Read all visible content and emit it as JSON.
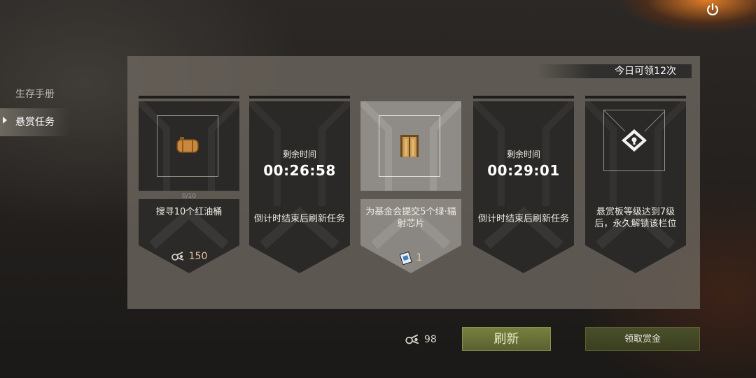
{
  "colors": {
    "panel": "#6e6860",
    "card_dark": "#2a2927",
    "card_highlight": "#8f8b86",
    "refresh_btn": "#6b7236",
    "claim_btn": "#434824",
    "reward_text": "#e3c49a"
  },
  "side_menu": {
    "items": [
      {
        "label": "生存手册",
        "active": false
      },
      {
        "label": "悬赏任务",
        "active": true
      }
    ]
  },
  "header": {
    "daily_claims": "今日可领12次",
    "power_icon": "power-icon"
  },
  "bounties": [
    {
      "type": "task",
      "icon": "red-oil-barrel-icon",
      "progress": "0/10",
      "description": "搜寻10个红油桶",
      "reward_icon": "scrap-parts-icon",
      "reward": "150",
      "highlighted": false
    },
    {
      "type": "timer",
      "timer_label": "剩余时间",
      "timer": "00:26:58",
      "description": "倒计时结束后刷新任务",
      "highlighted": false
    },
    {
      "type": "task",
      "icon": "door-icon",
      "progress": "0/5",
      "description": "为基金会提交5个绿·辐射芯片",
      "reward_icon": "chip-icon",
      "reward": "1",
      "highlighted": true
    },
    {
      "type": "timer",
      "timer_label": "剩余时间",
      "timer": "00:29:01",
      "description": "倒计时结束后刷新任务",
      "highlighted": false
    },
    {
      "type": "locked",
      "icon": "lock-icon",
      "description": "悬赏板等级达到7级后，永久解锁该栏位",
      "highlighted": false
    }
  ],
  "footer": {
    "currency_icon": "scrap-parts-icon",
    "currency_amount": "98",
    "refresh_label": "刷新",
    "claim_label": "领取赏金"
  }
}
